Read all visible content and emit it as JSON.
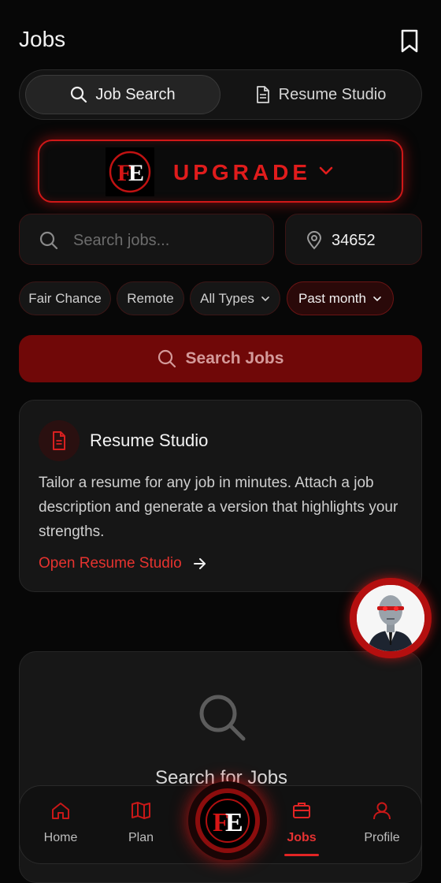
{
  "header": {
    "title": "Jobs"
  },
  "tabs": [
    {
      "label": "Job Search",
      "active": true
    },
    {
      "label": "Resume Studio",
      "active": false
    }
  ],
  "upgrade": {
    "label": "UPGRADE",
    "logo_text": "FE"
  },
  "search": {
    "placeholder": "Search jobs...",
    "location_value": "34652"
  },
  "filters": [
    {
      "label": "Fair Chance"
    },
    {
      "label": "Remote"
    },
    {
      "label": "All Types",
      "dropdown": true
    },
    {
      "label": "Past month",
      "dropdown": true,
      "active": true
    }
  ],
  "search_button": {
    "label": "Search Jobs"
  },
  "resume_card": {
    "title": "Resume Studio",
    "description": "Tailor a resume for any job in minutes. Attach a job description and generate a version that highlights your strengths.",
    "link": "Open Resume Studio"
  },
  "empty_state": {
    "title": "Search for Jobs"
  },
  "nav": {
    "items": [
      {
        "label": "Home",
        "icon": "home-icon"
      },
      {
        "label": "Plan",
        "icon": "map-icon"
      },
      {
        "label": "Jobs",
        "icon": "briefcase-icon",
        "active": true
      },
      {
        "label": "Profile",
        "icon": "user-icon"
      }
    ],
    "center_logo": "FE"
  },
  "colors": {
    "accent": "#e01c1c",
    "background": "#070707",
    "card": "#161616",
    "button": "#700808"
  }
}
